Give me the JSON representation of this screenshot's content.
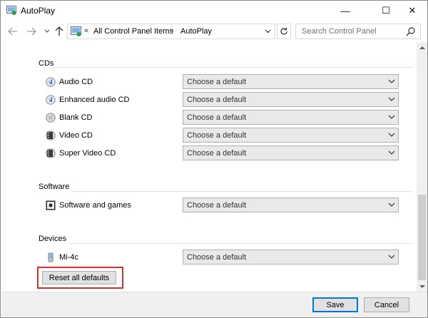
{
  "window": {
    "title": "AutoPlay",
    "controls": {
      "minimize": "—",
      "maximize": "☐",
      "close": "✕"
    }
  },
  "nav": {
    "back_icon": "arrow-left-icon",
    "forward_icon": "arrow-right-icon",
    "up_icon": "arrow-up-icon",
    "breadcrumb_overflow": "«",
    "breadcrumb": [
      "All Control Panel Items",
      "AutoPlay"
    ],
    "breadcrumb_separator": "›",
    "search_placeholder": "Search Control Panel"
  },
  "sections": {
    "cds": {
      "heading": "CDs",
      "items": [
        {
          "label": "Audio CD",
          "value": "Choose a default"
        },
        {
          "label": "Enhanced audio CD",
          "value": "Choose a default"
        },
        {
          "label": "Blank CD",
          "value": "Choose a default"
        },
        {
          "label": "Video CD",
          "value": "Choose a default"
        },
        {
          "label": "Super Video CD",
          "value": "Choose a default"
        }
      ]
    },
    "software": {
      "heading": "Software",
      "items": [
        {
          "label": "Software and games",
          "value": "Choose a default"
        }
      ]
    },
    "devices": {
      "heading": "Devices",
      "items": [
        {
          "label": "Mi-4c",
          "value": "Choose a default"
        }
      ]
    }
  },
  "reset_button": "Reset all defaults",
  "footer": {
    "save": "Save",
    "cancel": "Cancel"
  },
  "colors": {
    "highlight": "#d9302e",
    "accent": "#0078d7"
  }
}
